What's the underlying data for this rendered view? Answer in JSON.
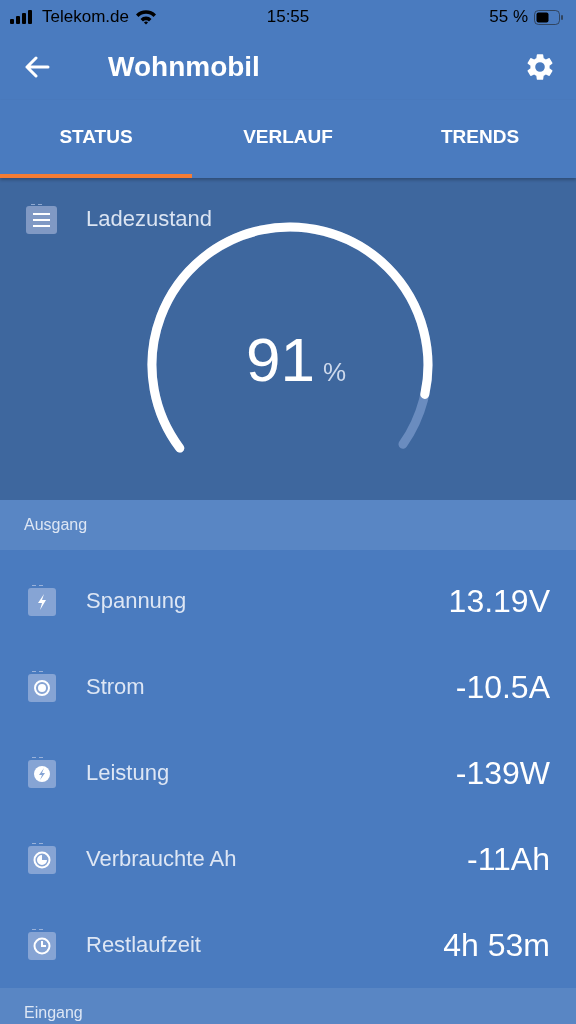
{
  "status_bar": {
    "carrier": "Telekom.de",
    "time": "15:55",
    "battery": "55 %"
  },
  "app_bar": {
    "title": "Wohnmobil"
  },
  "tabs": [
    {
      "label": "STATUS",
      "selected": true
    },
    {
      "label": "VERLAUF",
      "selected": false
    },
    {
      "label": "TRENDS",
      "selected": false
    }
  ],
  "gauge": {
    "label": "Ladezustand",
    "value": "91",
    "unit": "%"
  },
  "sections": [
    {
      "title": "Ausgang",
      "rows": [
        {
          "kind": "voltage",
          "label": "Spannung",
          "value": "13.19V"
        },
        {
          "kind": "current",
          "label": "Strom",
          "value": "-10.5A"
        },
        {
          "kind": "power",
          "label": "Leistung",
          "value": "-139W"
        },
        {
          "kind": "consumed",
          "label": "Verbrauchte Ah",
          "value": "-11Ah"
        },
        {
          "kind": "time",
          "label": "Restlaufzeit",
          "value": "4h 53m"
        }
      ]
    },
    {
      "title": "Eingang"
    }
  ]
}
